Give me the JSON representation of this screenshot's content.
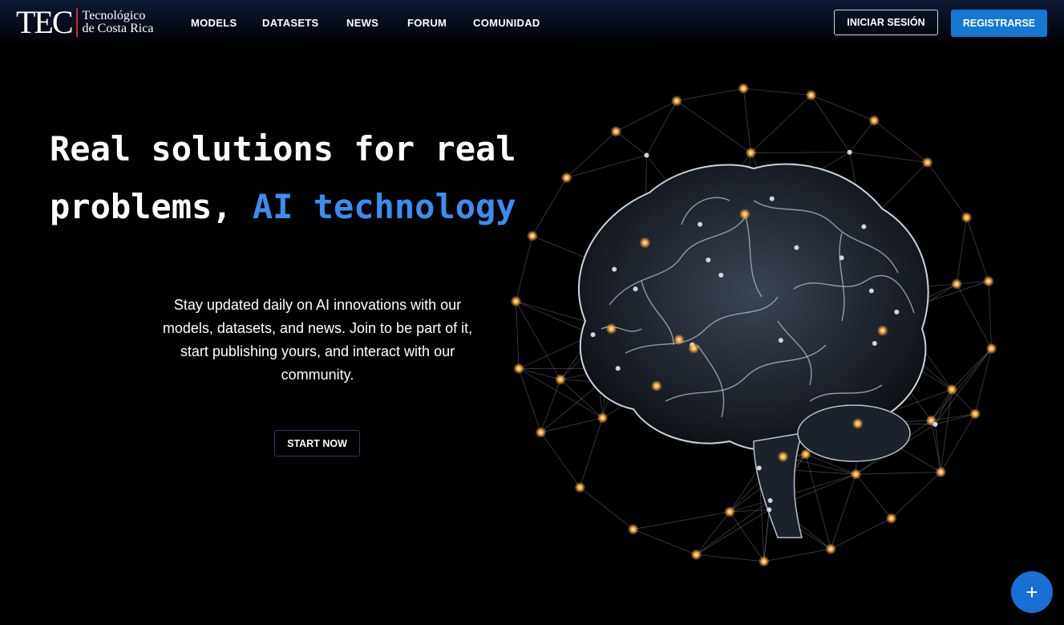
{
  "logo": {
    "mark": "TEC",
    "line1": "Tecnológico",
    "line2": "de Costa Rica"
  },
  "nav": {
    "items": [
      "MODELS",
      "DATASETS",
      "NEWS",
      "FORUM",
      "COMUNIDAD"
    ]
  },
  "auth": {
    "login": "INICIAR SESIÓN",
    "register": "REGISTRARSE"
  },
  "hero": {
    "line1": "Real solutions for real",
    "line2_plain": "problems, ",
    "line2_accent": "AI technology",
    "description": "Stay updated daily on AI innovations with our models, datasets, and news. Join to be part of it, start publishing yours, and interact with our community.",
    "cta": "START NOW"
  },
  "fab": {
    "icon": "plus-icon",
    "symbol": "+"
  },
  "colors": {
    "accent": "#3b8df0",
    "primary_button": "#1578d4",
    "fab": "#1a6fd6",
    "logo_bar": "#c0302b",
    "node_glow": "#ffb347"
  }
}
